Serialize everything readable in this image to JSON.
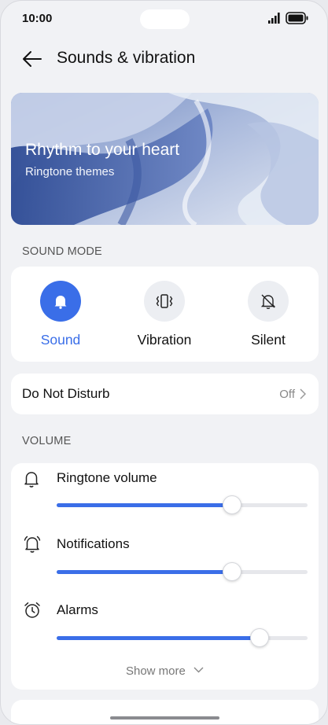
{
  "status_bar": {
    "time": "10:00"
  },
  "header": {
    "title": "Sounds & vibration"
  },
  "banner": {
    "title": "Rhythm to your heart",
    "subtitle": "Ringtone themes"
  },
  "sound_mode": {
    "section_label": "SOUND MODE",
    "modes": [
      {
        "label": "Sound",
        "icon": "bell-icon",
        "selected": true
      },
      {
        "label": "Vibration",
        "icon": "vibration-icon",
        "selected": false
      },
      {
        "label": "Silent",
        "icon": "bell-off-icon",
        "selected": false
      }
    ]
  },
  "do_not_disturb": {
    "label": "Do Not Disturb",
    "value": "Off"
  },
  "volume": {
    "section_label": "VOLUME",
    "items": [
      {
        "label": "Ringtone volume",
        "icon": "bell-icon",
        "level": 0.7
      },
      {
        "label": "Notifications",
        "icon": "notification-bell-icon",
        "level": 0.7
      },
      {
        "label": "Alarms",
        "icon": "alarm-clock-icon",
        "level": 0.81
      }
    ],
    "show_more": "Show more"
  },
  "colors": {
    "accent": "#3a6ee8",
    "background": "#f1f2f5",
    "card": "#ffffff"
  }
}
